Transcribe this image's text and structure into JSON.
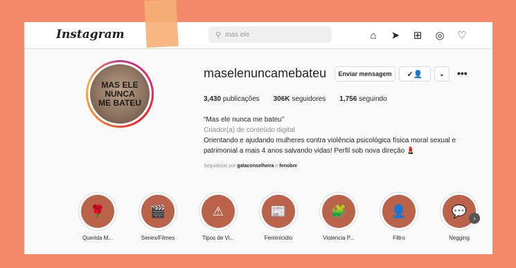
{
  "topbar": {
    "logo": "Instagram",
    "search_placeholder": "mas ele",
    "nav_icons": [
      "home-icon",
      "send-icon",
      "new-post-icon",
      "explore-icon",
      "heart-icon"
    ]
  },
  "profile": {
    "avatar_text": [
      "MAS ELE",
      "NUNCA",
      "ME BATEU"
    ],
    "username": "maselenuncamebateu",
    "message_button": "Enviar mensagem",
    "more": "•••",
    "stats": {
      "posts_count": "3,430",
      "posts_label": "publicações",
      "followers_count": "306K",
      "followers_label": "seguidores",
      "following_count": "1,756",
      "following_label": "seguindo"
    },
    "bio_name": "“Mas ele nunca me bateu”",
    "bio_category": "Criador(a) de conteúdo digital",
    "bio_line1": "Orientando e ajudando mulheres contra violência psicológica física moral sexual e",
    "bio_line2": "patrimonial a mais 4 anos salvando vidas! Perfil sob nova direção 💄",
    "followed_by_prefix": "Seguido(a) por",
    "followed_by_1": "gataconselheira",
    "followed_by_and": "e",
    "followed_by_2": "fenobre"
  },
  "highlights": [
    {
      "label": "Querida M...",
      "icon": "🌹"
    },
    {
      "label": "Series/Filmes",
      "icon": "🎬"
    },
    {
      "label": "Tipos de Vi...",
      "icon": "⚠"
    },
    {
      "label": "Feminicidio",
      "icon": "📰"
    },
    {
      "label": "Violencia P...",
      "icon": "🧩"
    },
    {
      "label": "Filtro",
      "icon": "👤"
    },
    {
      "label": "Negging",
      "icon": "💬"
    }
  ],
  "colors": {
    "background": "#f58a6b",
    "tape": "#f6b077",
    "highlight_bg": "#b9634a"
  }
}
